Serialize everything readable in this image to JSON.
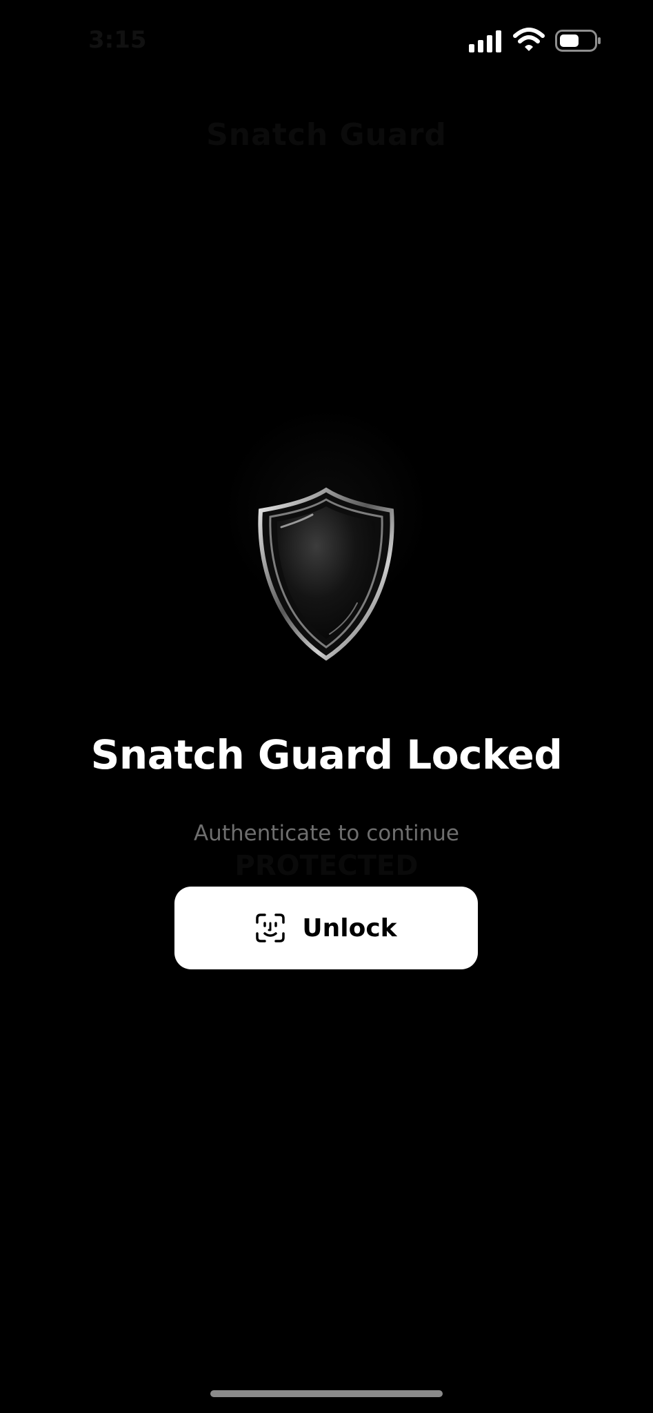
{
  "status_bar": {
    "time": "3:15",
    "signal_icon": "cellular-signal-icon",
    "wifi_icon": "wifi-icon",
    "battery_icon": "battery-icon"
  },
  "background": {
    "ghost_title": "Snatch Guard",
    "ghost_subtitle": "PROTECTED"
  },
  "lock_screen": {
    "icon": "shield-icon",
    "title": "Snatch Guard Locked",
    "subtitle": "Authenticate to continue",
    "unlock_button": {
      "icon": "face-id-icon",
      "label": "Unlock"
    }
  },
  "colors": {
    "background": "#000000",
    "title": "#ffffff",
    "subtitle": "#6e6e6e",
    "button_bg": "#ffffff",
    "button_text": "#000000"
  }
}
